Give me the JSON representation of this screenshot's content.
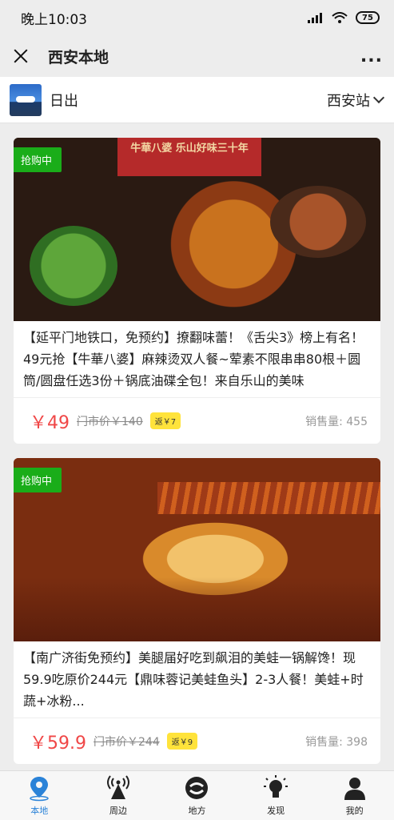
{
  "status_bar": {
    "time": "晚上10:03",
    "battery": "75"
  },
  "title_bar": {
    "title": "西安本地",
    "more": "..."
  },
  "location": {
    "name": "日出",
    "station": "西安站"
  },
  "cards": [
    {
      "badge": "抢购中",
      "sign": "牛華八婆  乐山好味三十年",
      "description": "【延平门地铁口，免预约】撩翻味蕾！《舌尖3》榜上有名！49元抢【牛華八婆】麻辣烫双人餐~荤素不限串串80根＋圆筒/圆盘任选3份＋锅底油碟全包！来自乐山的美味",
      "price": "￥49",
      "original_price": "门市价￥140",
      "rebate": "返￥7",
      "sales": "销售量: 455"
    },
    {
      "badge": "抢购中",
      "description": "【南广济街免预约】美腿届好吃到飙泪的美蛙一锅解馋！现59.9吃原价244元【鼎味蓉记美蛙鱼头】2-3人餐！美蛙+时蔬+冰粉...",
      "price": "￥59.9",
      "original_price": "门市价￥244",
      "rebate": "返￥9",
      "sales": "销售量: 398"
    }
  ],
  "tabbar": {
    "tabs": [
      {
        "label": "本地",
        "icon": "location-pin-icon",
        "active": true
      },
      {
        "label": "周边",
        "icon": "signal-tower-icon",
        "active": false
      },
      {
        "label": "地方",
        "icon": "swirl-logo-icon",
        "active": false
      },
      {
        "label": "发现",
        "icon": "lightbulb-icon",
        "active": false
      },
      {
        "label": "我的",
        "icon": "person-icon",
        "active": false
      }
    ]
  },
  "colors": {
    "accent": "#2b83d8",
    "price": "#f04747",
    "badge": "#1aad19",
    "rebate": "#ffe33b"
  }
}
